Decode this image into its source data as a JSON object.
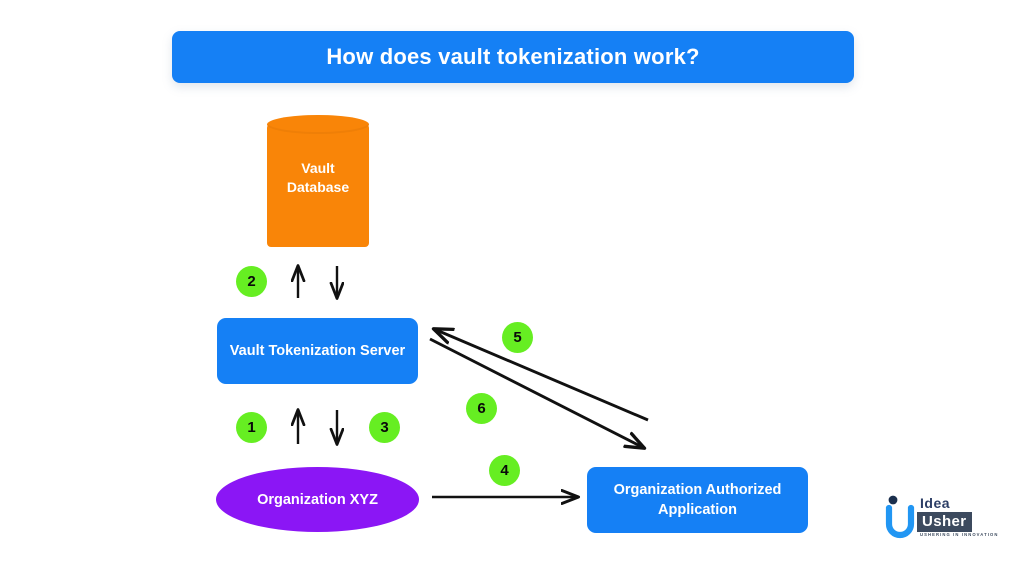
{
  "title": {
    "text": "How does vault tokenization work?"
  },
  "nodes": {
    "vault_database": {
      "label_line1": "Vault",
      "label_line2": "Database",
      "shape": "cylinder",
      "color": "#F98508"
    },
    "vault_server": {
      "label": "Vault Tokenization Server",
      "shape": "rounded-rectangle",
      "color": "#1580F5"
    },
    "organization": {
      "label": "Organization XYZ",
      "shape": "ellipse",
      "color": "#8B16F5"
    },
    "authorized_app": {
      "label": "Organization Authorized Application",
      "shape": "rounded-rectangle",
      "color": "#1580F5"
    }
  },
  "badges": [
    {
      "number": "1",
      "color": "#66EE22"
    },
    {
      "number": "2",
      "color": "#66EE22"
    },
    {
      "number": "3",
      "color": "#66EE22"
    },
    {
      "number": "4",
      "color": "#66EE22"
    },
    {
      "number": "5",
      "color": "#66EE22"
    },
    {
      "number": "6",
      "color": "#66EE22"
    }
  ],
  "logo": {
    "word_top": "Idea",
    "word_bottom": "Usher",
    "tagline": "USHERING IN INNOVATION"
  },
  "colors": {
    "background": "#FFFFFF",
    "brand_blue": "#1580F5",
    "orange": "#F98508",
    "purple": "#8B16F5",
    "badge_green": "#66EE22",
    "arrow_black": "#111111"
  },
  "chart_data": {
    "type": "diagram",
    "title": "How does vault tokenization work?",
    "nodes": [
      {
        "id": "vault_database",
        "label": "Vault Database",
        "shape": "cylinder",
        "color": "#F98508"
      },
      {
        "id": "vault_server",
        "label": "Vault Tokenization Server",
        "shape": "rounded-rectangle",
        "color": "#1580F5"
      },
      {
        "id": "organization",
        "label": "Organization XYZ",
        "shape": "ellipse",
        "color": "#8B16F5"
      },
      {
        "id": "authorized_app",
        "label": "Organization Authorized Application",
        "shape": "rounded-rectangle",
        "color": "#1580F5"
      }
    ],
    "edges": [
      {
        "step": "1",
        "from": "organization",
        "to": "vault_server",
        "direction": "up"
      },
      {
        "step": "2",
        "from": "vault_server",
        "to": "vault_database",
        "direction": "up-and-down"
      },
      {
        "step": "3",
        "from": "vault_server",
        "to": "organization",
        "direction": "down"
      },
      {
        "step": "4",
        "from": "organization",
        "to": "authorized_app",
        "direction": "right"
      },
      {
        "step": "5",
        "from": "authorized_app",
        "to": "vault_server",
        "direction": "up-left"
      },
      {
        "step": "6",
        "from": "vault_server",
        "to": "authorized_app",
        "direction": "down-right"
      }
    ]
  }
}
